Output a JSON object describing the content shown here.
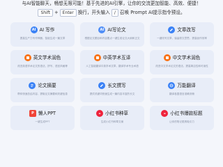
{
  "intro": {
    "line1": "与AI智能聊天，畅想无限可能！基于先进的AI引擎，让你的交流更加智能、高效、便捷！",
    "line2_prefix": "",
    "key_shift": "Shift",
    "plus": "+",
    "key_enter": "Enter",
    "line2_mid": "换行，开头输入",
    "key_slash": "/",
    "line2_suffix": "召唤 Prompt AI提示指令预设。"
  },
  "cards": [
    {
      "title": "AI 写作",
      "desc": "提高生产力写作神器，智能生成一篇文章",
      "icon": "ai-pen-icon",
      "color": "#3b82f6"
    },
    {
      "title": "AI写论文",
      "desc": "根据论文题目和内容要点一键生成论文大纲和正文",
      "icon": "paper-icon",
      "color": "#4f8ef7"
    },
    {
      "title": "文章改写",
      "desc": "一键改写文章，保留原文意思，提高创作效率",
      "icon": "rewrite-icon",
      "color": "#3b82f6"
    },
    {
      "title": "英文学术润色",
      "desc": "改进英语学术论文的语法、拼写、语言风格等",
      "icon": "en-polish-icon",
      "color": "#f97316"
    },
    {
      "title": "中英学术互译",
      "desc": "人工智能翻译中英学术文章，翻译学术专业术语",
      "icon": "translate-icon",
      "color": "#f97316"
    },
    {
      "title": "中文学术润色",
      "desc": "改进中文学术论文的语法、提高简洁性和可读性",
      "icon": "cn-polish-icon",
      "color": "#f97316"
    },
    {
      "title": "论文摘要",
      "desc": "帮你快速总结内容，提取论文摘要和关键信息",
      "icon": "abstract-icon",
      "color": "#3b82f6"
    },
    {
      "title": "长文撰写",
      "desc": "提供关键词快速生成一篇内容丰富的长文",
      "icon": "long-text-icon",
      "color": "#3b82f6"
    },
    {
      "title": "万能翻译",
      "desc": "翻译各国语言准确流畅",
      "icon": "globe-translate-icon",
      "color": "#3b82f6"
    },
    {
      "title": "懒人PPT",
      "desc": "一键生成PPT",
      "icon": "ppt-icon",
      "color": "#f04438"
    },
    {
      "title": "小红书种草",
      "desc": "生成小红书种草文案",
      "icon": "xiaohongshu-icon",
      "color": "#ef233c"
    },
    {
      "title": "小红书爆款标题",
      "desc": "让你的笔记更具吸引力",
      "icon": "xiaohongshu-title-icon",
      "color": "#ef233c"
    }
  ]
}
